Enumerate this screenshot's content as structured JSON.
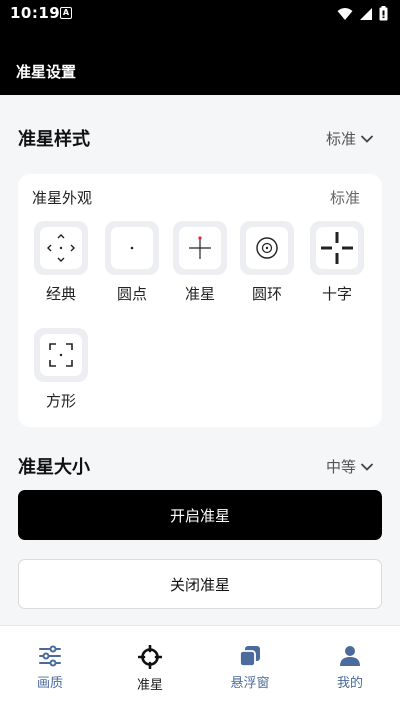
{
  "status_bar": {
    "time": "10:19",
    "notification_letter": "A"
  },
  "app_bar": {
    "title": "准星设置"
  },
  "crosshair_style": {
    "label": "准星样式",
    "value": "标准",
    "card": {
      "title": "准星外观",
      "value": "标准",
      "options": [
        {
          "label": "经典",
          "icon": "classic-crosshair-icon"
        },
        {
          "label": "圆点",
          "icon": "dot-crosshair-icon"
        },
        {
          "label": "准星",
          "icon": "plus-crosshair-icon"
        },
        {
          "label": "圆环",
          "icon": "ring-crosshair-icon"
        },
        {
          "label": "十字",
          "icon": "cross-crosshair-icon"
        },
        {
          "label": "方形",
          "icon": "square-crosshair-icon"
        }
      ]
    }
  },
  "crosshair_size": {
    "label": "准星大小",
    "value": "中等"
  },
  "buttons": {
    "enable": "开启准星",
    "disable": "关闭准星"
  },
  "tabbar": {
    "active_index": 1,
    "items": [
      {
        "label": "画质",
        "icon": "sliders-icon"
      },
      {
        "label": "准星",
        "icon": "crosshair-icon"
      },
      {
        "label": "悬浮窗",
        "icon": "floating-window-icon"
      },
      {
        "label": "我的",
        "icon": "person-icon"
      }
    ]
  },
  "colors": {
    "accent": "#000000",
    "tab_inactive": "#4a6b9c",
    "background": "#f5f6f8"
  }
}
